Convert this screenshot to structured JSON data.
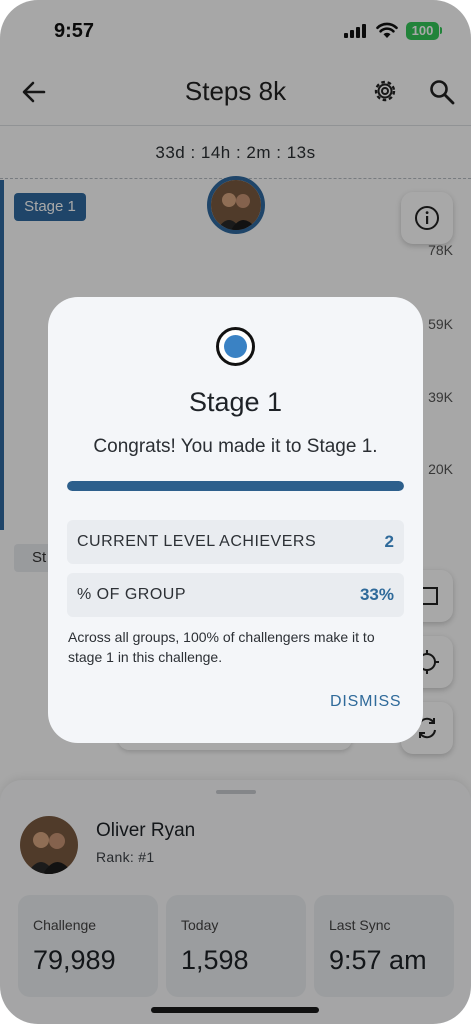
{
  "status_bar": {
    "time": "9:57",
    "battery": "100"
  },
  "header": {
    "title": "Steps 8k"
  },
  "countdown": "33d : 14h : 2m : 13s",
  "chart": {
    "stage_label": "Stage 1",
    "stage_label_2": "St",
    "y_ticks": [
      "78K",
      "59K",
      "39K",
      "20K"
    ]
  },
  "user": {
    "name": "Oliver Ryan",
    "rank": "Rank: #1"
  },
  "stats": [
    {
      "label": "Challenge",
      "value": "79,989"
    },
    {
      "label": "Today",
      "value": "1,598"
    },
    {
      "label": "Last Sync",
      "value": "9:57 am"
    }
  ],
  "dialog": {
    "title": "Stage 1",
    "message": "Congrats! You made it to Stage 1.",
    "progress": 1.0,
    "rows": [
      {
        "label": "CURRENT LEVEL ACHIEVERS",
        "value": "2"
      },
      {
        "label": "% OF GROUP",
        "value": "33%"
      }
    ],
    "note": "Across all groups, 100% of challengers make it to stage 1 in this challenge.",
    "dismiss_label": "DISMISS"
  },
  "colors": {
    "accent": "#2f6aa0",
    "battery": "#34c759",
    "stage_dot": "#3a82c4"
  }
}
